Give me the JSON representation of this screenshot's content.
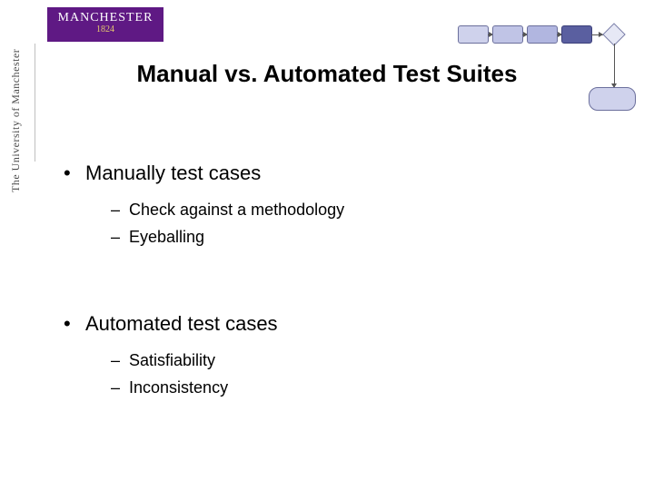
{
  "logo": {
    "line1": "MANCHESTER",
    "line2": "1824"
  },
  "institution": "The University of Manchester",
  "title": "Manual vs. Automated Test Suites",
  "bullets": [
    {
      "text": "Manually test cases",
      "subs": [
        "Check against a methodology",
        "Eyeballing"
      ]
    },
    {
      "text": "Automated test cases",
      "subs": [
        "Satisfiability",
        "Inconsistency"
      ]
    }
  ],
  "colors": {
    "brand": "#5f1984",
    "gold": "#e6c96e",
    "flowchart_active": "#5a5fa0"
  }
}
